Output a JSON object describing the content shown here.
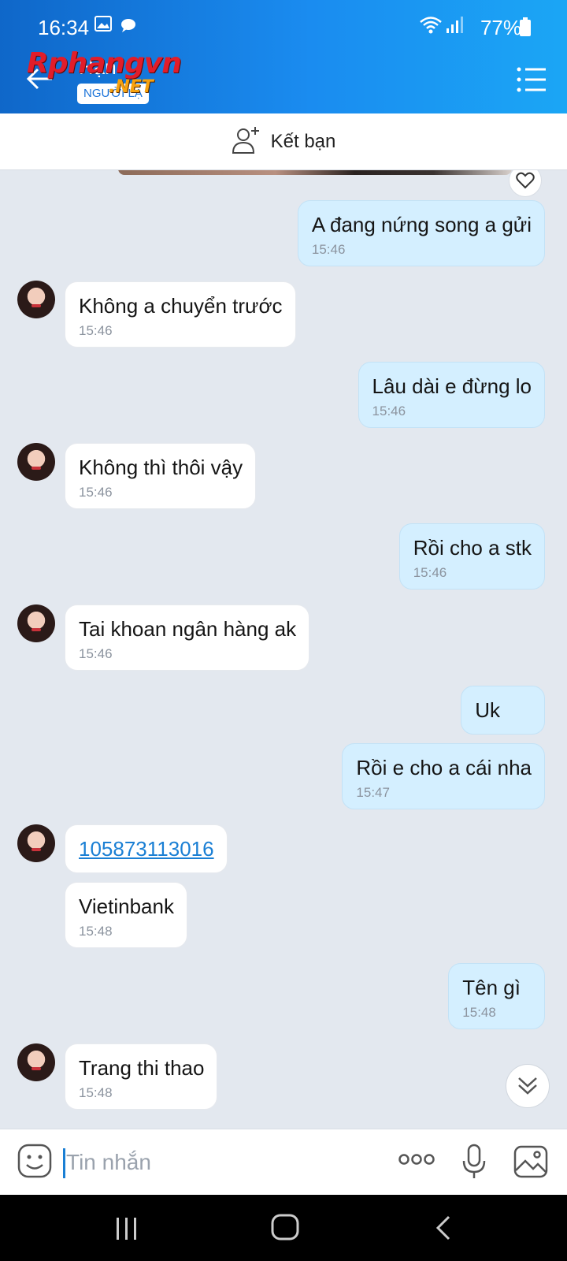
{
  "status_bar": {
    "time": "16:34",
    "battery": "77%"
  },
  "header": {
    "contact_name": "Hạn",
    "relation_badge": "NGƯỜI LẠ",
    "watermark_main": "Rphangvn",
    "watermark_sub": ".NET"
  },
  "add_friend": {
    "label": "Kết bạn"
  },
  "messages": [
    {
      "side": "out",
      "text": "A đang nứng song a gửi",
      "time": "15:46"
    },
    {
      "side": "in",
      "text": "Không a chuyển trước",
      "time": "15:46"
    },
    {
      "side": "out",
      "text": "Lâu dài e đừng lo",
      "time": "15:46"
    },
    {
      "side": "in",
      "text": "Không thì thôi vậy",
      "time": "15:46"
    },
    {
      "side": "out",
      "text": "Rồi cho a stk",
      "time": "15:46"
    },
    {
      "side": "in",
      "text": "Tai khoan ngân hàng ak",
      "time": "15:46"
    },
    {
      "side": "out",
      "text": "Uk",
      "time": ""
    },
    {
      "side": "out",
      "text": "Rồi e cho a cái nha",
      "time": "15:47"
    },
    {
      "side": "in",
      "text": "105873113016",
      "time": "",
      "link": true
    },
    {
      "side": "in",
      "text": "Vietinbank",
      "time": "15:48"
    },
    {
      "side": "out",
      "text": "Tên gì",
      "time": "15:48"
    },
    {
      "side": "in",
      "text": "Trang thi thao",
      "time": "15:48"
    }
  ],
  "composer": {
    "placeholder": "Tin nhắn"
  },
  "icons": {
    "back": "back-arrow-icon",
    "menu": "list-menu-icon",
    "add_friend": "add-person-icon",
    "heart": "heart-icon",
    "scroll": "double-chevron-down-icon",
    "emoji": "emoji-icon",
    "more": "more-dots-icon",
    "mic": "microphone-icon",
    "gallery": "image-icon"
  },
  "colors": {
    "header_start": "#0f67c9",
    "header_end": "#1ba6f5",
    "outgoing_bubble": "#d4efff",
    "incoming_bubble": "#ffffff",
    "chat_bg": "#e3e8ef",
    "link": "#1a7fd4"
  }
}
